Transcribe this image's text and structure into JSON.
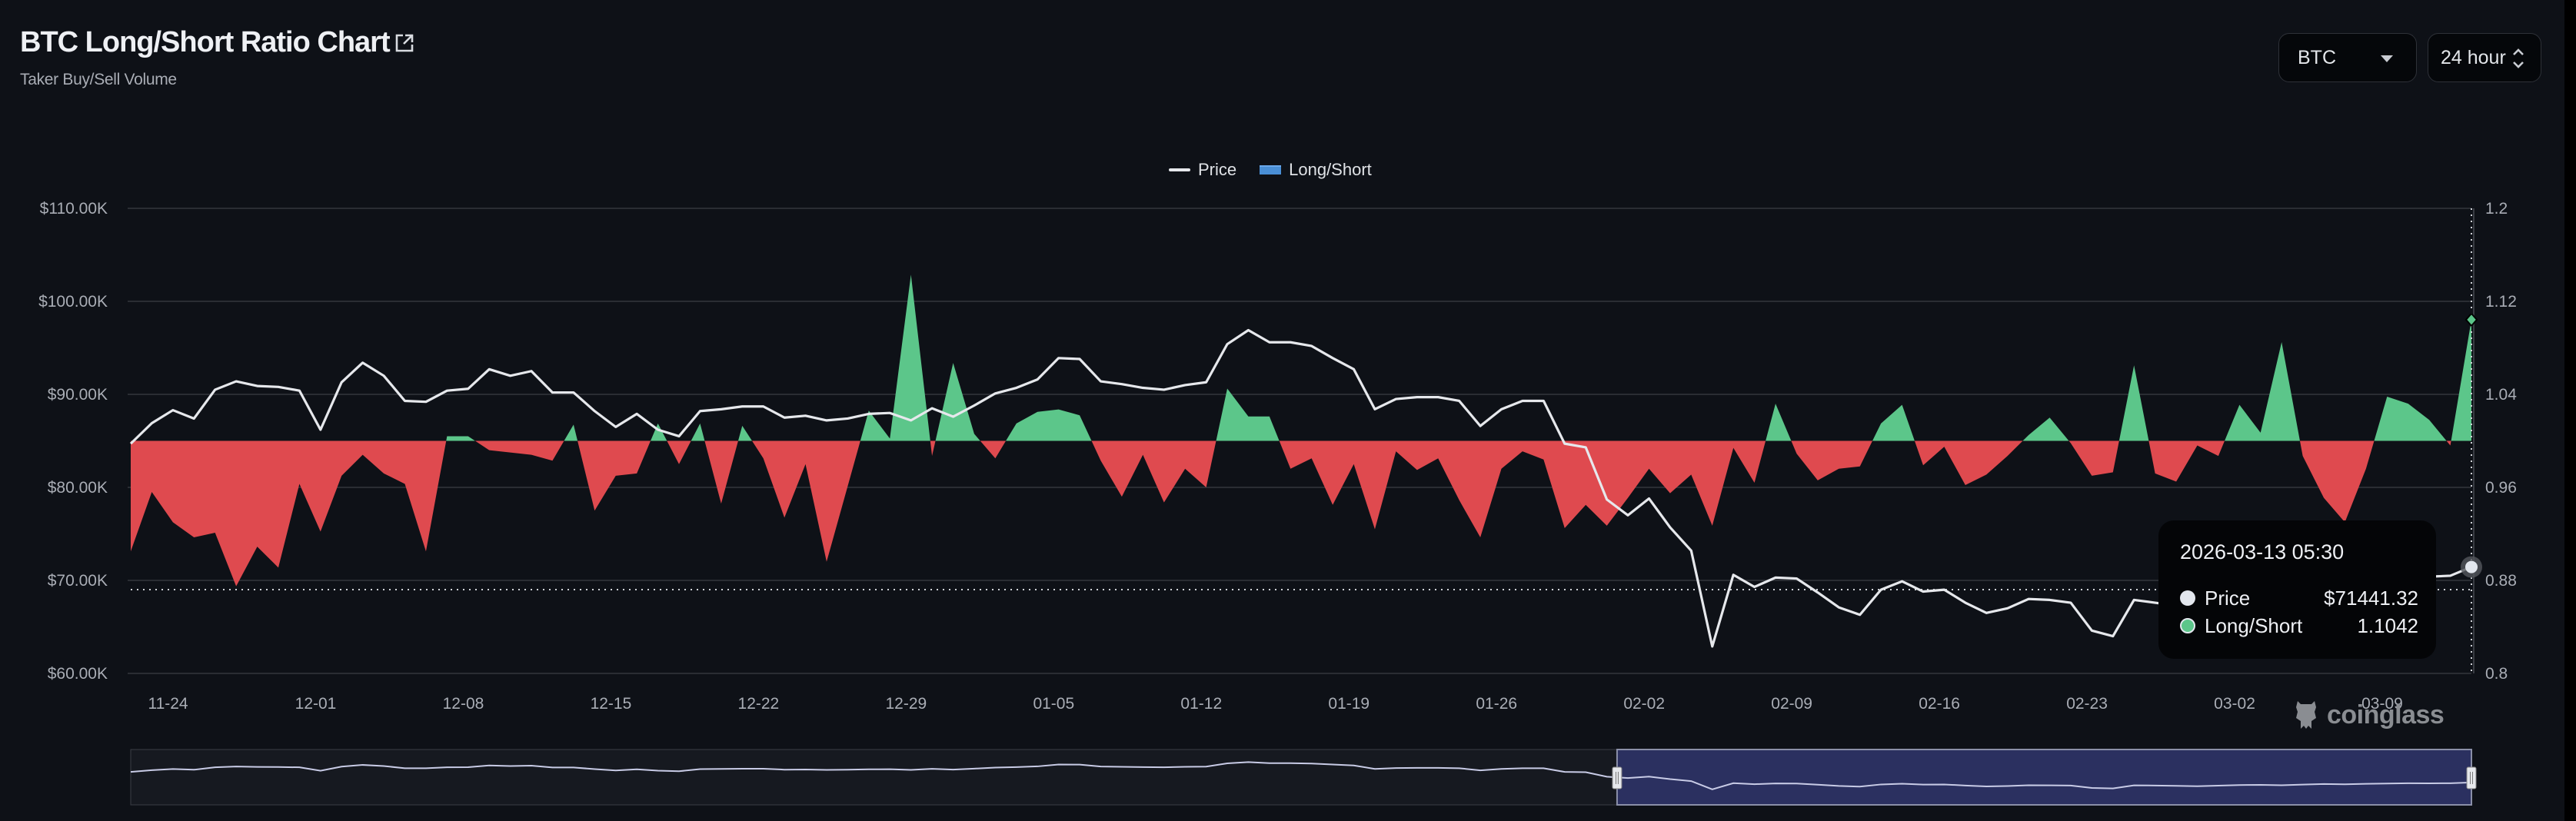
{
  "header": {
    "title": "BTC Long/Short Ratio Chart",
    "subtitle": "Taker Buy/Sell Volume",
    "link_icon": "external-link-icon"
  },
  "controls": {
    "symbol": "BTC",
    "interval": "24 hour"
  },
  "legend": {
    "price": "Price",
    "long_short": "Long/Short"
  },
  "tooltip": {
    "datetime": "2026-03-13 05:30",
    "price_label": "Price",
    "price_value": "$71441.32",
    "ls_label": "Long/Short",
    "ls_value": "1.1042"
  },
  "watermark": "coinglass",
  "colors": {
    "background": "#0e1117",
    "grid": "#2a2d33",
    "price_line": "#e6e8ec",
    "long": "#5cc68a",
    "short": "#df4a4f",
    "legend_long_short": "#4a8fd6",
    "navigator_selection": "#2b3060"
  },
  "navigator": {
    "selection": [
      0.635,
      1.0
    ]
  },
  "chart_data": {
    "type": "line+area",
    "title": "BTC Long/Short Ratio Chart",
    "x_start": "2025-11-22 05:30",
    "x_interval": "1d",
    "x_tick_labels": [
      "11-24",
      "12-01",
      "12-08",
      "12-15",
      "12-22",
      "12-29",
      "01-05",
      "01-12",
      "01-19",
      "01-26",
      "02-02",
      "02-09",
      "02-16",
      "02-23",
      "03-02",
      "03-09"
    ],
    "x_tick_first_index": 1.77,
    "x_tick_step": 7,
    "hover_index": 111,
    "baseline": 1.0,
    "y_left": {
      "name": "Price",
      "unit": "K USD",
      "range": [
        60,
        110
      ],
      "ticks": [
        60,
        70,
        80,
        90,
        100,
        110
      ],
      "tick_labels": [
        "$60.00K",
        "$70.00K",
        "$80.00K",
        "$90.00K",
        "$100.00K",
        "$110.00K"
      ]
    },
    "y_right": {
      "name": "Long/Short",
      "range": [
        0.8,
        1.2
      ],
      "ticks": [
        0.8,
        0.88,
        0.96,
        1.04,
        1.12,
        1.2
      ],
      "tick_labels": [
        "0.8",
        "0.88",
        "0.96",
        "1.04",
        "1.12",
        "1.2"
      ]
    },
    "series": [
      {
        "name": "Price",
        "type": "line",
        "axis": "left",
        "values": [
          84.7,
          86.9,
          88.3,
          87.4,
          90.5,
          91.4,
          90.9,
          90.8,
          90.4,
          86.2,
          91.3,
          93.4,
          92.0,
          89.3,
          89.2,
          90.4,
          90.6,
          92.7,
          92.0,
          92.5,
          90.2,
          90.2,
          88.2,
          86.5,
          87.9,
          86.2,
          85.5,
          88.2,
          88.4,
          88.7,
          88.7,
          87.5,
          87.7,
          87.2,
          87.4,
          87.9,
          88.0,
          87.2,
          88.5,
          87.6,
          88.8,
          90.1,
          90.7,
          91.6,
          93.9,
          93.8,
          91.4,
          91.1,
          90.7,
          90.5,
          91.0,
          91.3,
          95.4,
          96.9,
          95.6,
          95.6,
          95.2,
          93.9,
          92.7,
          88.4,
          89.5,
          89.7,
          89.7,
          89.3,
          86.6,
          88.4,
          89.3,
          89.3,
          84.7,
          84.3,
          78.7,
          77.0,
          78.8,
          75.7,
          73.2,
          62.9,
          70.6,
          69.3,
          70.3,
          70.2,
          68.7,
          67.1,
          66.3,
          69.0,
          69.9,
          68.8,
          69.0,
          67.6,
          66.5,
          67.0,
          68.0,
          67.9,
          67.6,
          64.6,
          64.0,
          67.9,
          67.6,
          67.3,
          66.8,
          67.5,
          68.2,
          68.5,
          68.0,
          68.8,
          69.5,
          69.2,
          69.8,
          70.2,
          70.5,
          70.4,
          70.5,
          71.44
        ]
      },
      {
        "name": "Long/Short",
        "type": "area",
        "axis": "right",
        "values": [
          0.905,
          0.956,
          0.93,
          0.917,
          0.921,
          0.875,
          0.909,
          0.891,
          0.963,
          0.922,
          0.97,
          0.988,
          0.972,
          0.963,
          0.905,
          1.004,
          1.004,
          0.992,
          0.99,
          0.988,
          0.983,
          1.014,
          0.94,
          0.97,
          0.972,
          1.015,
          0.98,
          1.015,
          0.946,
          1.013,
          0.985,
          0.934,
          0.98,
          0.896,
          0.961,
          1.026,
          1.002,
          1.143,
          0.987,
          1.067,
          1.006,
          0.985,
          1.015,
          1.025,
          1.027,
          1.022,
          0.983,
          0.952,
          0.988,
          0.947,
          0.976,
          0.96,
          1.045,
          1.021,
          1.021,
          0.976,
          0.985,
          0.945,
          0.98,
          0.924,
          0.991,
          0.975,
          0.985,
          0.949,
          0.917,
          0.976,
          0.991,
          0.984,
          0.925,
          0.945,
          0.927,
          0.951,
          0.976,
          0.955,
          0.971,
          0.927,
          0.994,
          0.964,
          1.032,
          0.989,
          0.966,
          0.976,
          0.978,
          1.015,
          1.031,
          0.979,
          0.995,
          0.962,
          0.971,
          0.987,
          1.005,
          1.02,
          0.998,
          0.97,
          0.973,
          1.065,
          0.972,
          0.965,
          0.996,
          0.987,
          1.031,
          1.007,
          1.085,
          0.987,
          0.951,
          0.93,
          0.976,
          1.038,
          1.032,
          1.018,
          0.996,
          1.1042
        ]
      }
    ]
  }
}
